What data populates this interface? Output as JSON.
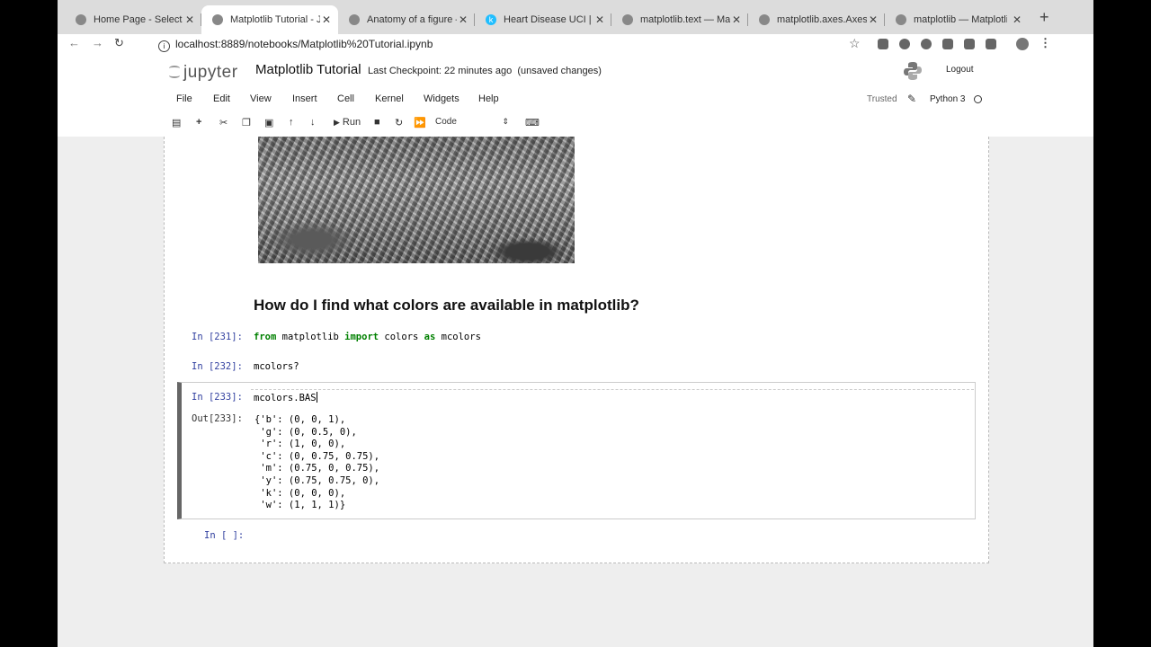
{
  "browser": {
    "tabs": [
      {
        "title": "Home Page - Select or",
        "active": false
      },
      {
        "title": "Matplotlib Tutorial - Jupyter",
        "active": true
      },
      {
        "title": "Anatomy of a figure —",
        "active": false
      },
      {
        "title": "Heart Disease UCI | Kaggle",
        "active": false
      },
      {
        "title": "matplotlib.text — Matplotlib",
        "active": false
      },
      {
        "title": "matplotlib.axes.Axes.text",
        "active": false
      },
      {
        "title": "matplotlib — Matplotlib",
        "active": false
      }
    ],
    "url": "localhost:8889/notebooks/Matplotlib%20Tutorial.ipynb"
  },
  "jupyter": {
    "logo_text": "jupyter",
    "notebook_title": "Matplotlib Tutorial",
    "checkpoint": "Last Checkpoint: 22 minutes ago",
    "unsaved": "(unsaved changes)",
    "logout": "Logout",
    "menu": [
      "File",
      "Edit",
      "View",
      "Insert",
      "Cell",
      "Kernel",
      "Widgets",
      "Help"
    ],
    "trusted": "Trusted",
    "kernel": "Python 3",
    "toolbar": {
      "run_label": "Run",
      "cell_type": "Code"
    }
  },
  "notebook": {
    "heading": "How do I find what colors are available in matplotlib?",
    "cells": [
      {
        "prompt": "In [231]:",
        "code_parts": [
          "from",
          " matplotlib ",
          "import",
          " colors ",
          "as",
          " mcolors"
        ]
      },
      {
        "prompt": "In [232]:",
        "code": "mcolors?"
      },
      {
        "prompt": "In [233]:",
        "code": "mcolors.BAS"
      },
      {
        "prompt": "In [ ]:",
        "code": ""
      }
    ],
    "output_prompt": "Out[233]:",
    "output_lines": [
      "{'b': (0, 0, 1),",
      " 'g': (0, 0.5, 0),",
      " 'r': (1, 0, 0),",
      " 'c': (0, 0.75, 0.75),",
      " 'm': (0.75, 0, 0.75),",
      " 'y': (0.75, 0.75, 0),",
      " 'k': (0, 0, 0),",
      " 'w': (1, 1, 1)}"
    ]
  }
}
